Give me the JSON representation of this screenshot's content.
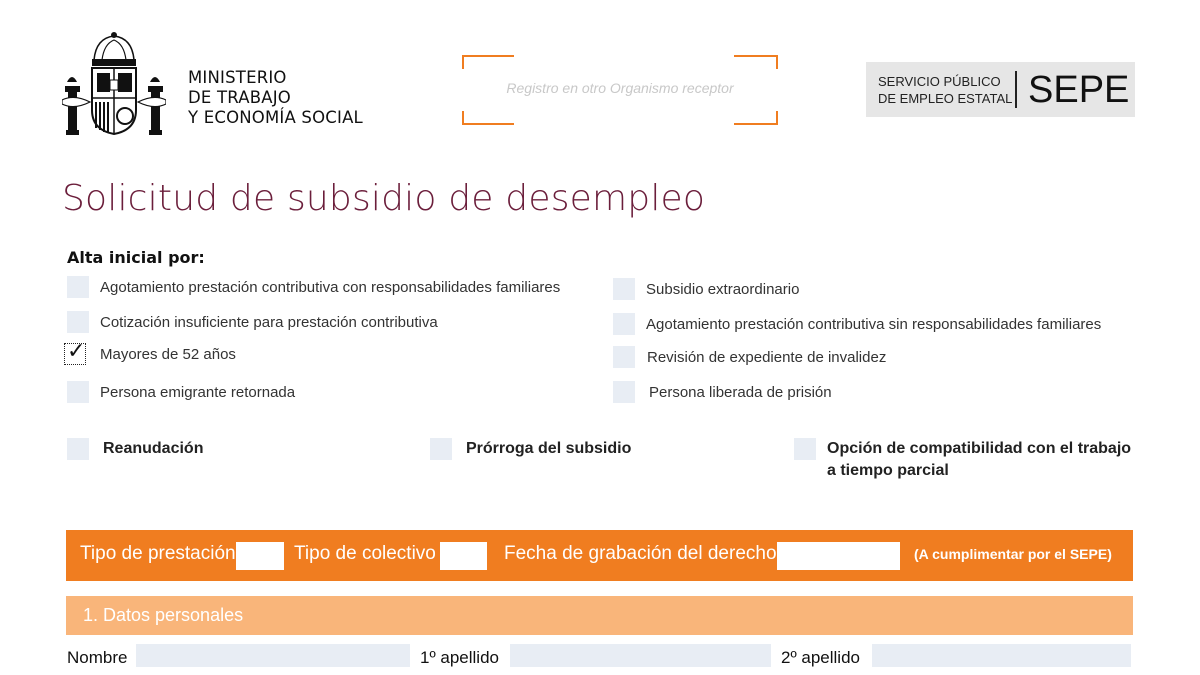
{
  "header": {
    "ministry_lines": [
      "MINISTERIO",
      "DE TRABAJO",
      "Y ECONOMÍA SOCIAL"
    ],
    "registro_placeholder": "Registro en otro Organismo receptor",
    "sepe_small_lines": [
      "SERVICIO PÚBLICO",
      "DE EMPLEO ESTATAL"
    ],
    "sepe_logo": "SEPE"
  },
  "form": {
    "title": "Solicitud de subsidio de desempleo",
    "alta_heading": "Alta inicial por:",
    "alta_left": [
      {
        "label": "Agotamiento prestación contributiva con responsabilidades familiares",
        "checked": false
      },
      {
        "label": "Cotización insuficiente para prestación contributiva",
        "checked": false
      },
      {
        "label": "Mayores de 52 años",
        "checked": true
      },
      {
        "label": "Persona emigrante retornada",
        "checked": false
      }
    ],
    "alta_right": [
      {
        "label": "Subsidio extraordinario",
        "checked": false
      },
      {
        "label": "Agotamiento prestación contributiva sin responsabilidades familiares",
        "checked": false
      },
      {
        "label": "Revisión de expediente de invalidez",
        "checked": false
      },
      {
        "label": "Persona liberada de prisión",
        "checked": false
      }
    ],
    "other_options": [
      {
        "label": "Reanudación",
        "checked": false
      },
      {
        "label": "Prórroga del subsidio",
        "checked": false
      },
      {
        "label_lines": [
          "Opción de compatibilidad con el trabajo",
          "a tiempo parcial"
        ],
        "checked": false
      }
    ],
    "check_mark": "✓",
    "sepe_bar": {
      "tipo_prestacion": "Tipo de prestación",
      "tipo_colectivo": "Tipo de colectivo",
      "fecha_grabacion": "Fecha de grabación del derecho",
      "note": "(A cumplimentar por el SEPE)"
    },
    "section_1": {
      "title": "1. Datos personales",
      "fields": [
        "Nombre",
        "1º apellido",
        "2º apellido"
      ]
    }
  },
  "colors": {
    "orange": "#f07d20",
    "light_orange": "#f9b57a",
    "title": "#6b1e3b",
    "field_fill": "#e8edf4"
  },
  "icons": {
    "crest": "spanish-coat-of-arms-icon",
    "check": "check-mark-icon"
  }
}
